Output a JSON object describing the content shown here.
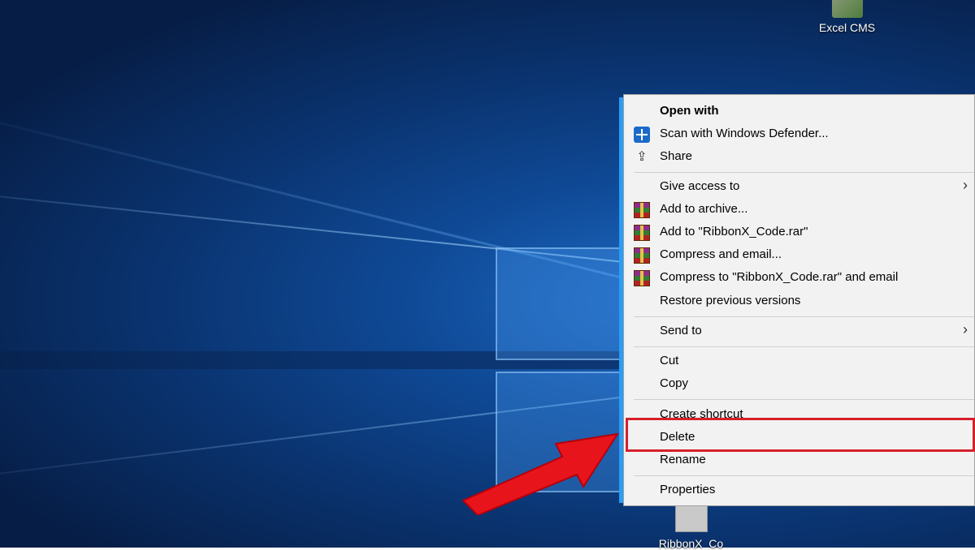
{
  "desktop": {
    "icons": [
      {
        "label": "Excel CMS",
        "icon": "excel-file-icon"
      },
      {
        "label": "RibbonX_Co",
        "icon": "file-icon"
      }
    ]
  },
  "context_menu": {
    "items": [
      {
        "label": "Open with",
        "bold": true
      },
      {
        "label": "Scan with Windows Defender...",
        "icon": "windows-defender-icon"
      },
      {
        "label": "Share",
        "icon": "share-icon"
      },
      {
        "label": "Give access to",
        "submenu": true
      },
      {
        "label": "Add to archive...",
        "icon": "winrar-icon"
      },
      {
        "label": "Add to \"RibbonX_Code.rar\"",
        "icon": "winrar-icon"
      },
      {
        "label": "Compress and email...",
        "icon": "winrar-icon"
      },
      {
        "label": "Compress to \"RibbonX_Code.rar\" and email",
        "icon": "winrar-icon"
      },
      {
        "label": "Restore previous versions"
      },
      {
        "label": "Send to",
        "submenu": true
      },
      {
        "label": "Cut"
      },
      {
        "label": "Copy"
      },
      {
        "label": "Create shortcut"
      },
      {
        "label": "Delete",
        "highlighted": true
      },
      {
        "label": "Rename"
      },
      {
        "label": "Properties"
      }
    ],
    "submenu_arrow": "›"
  },
  "annotation": {
    "highlight_color": "#d6202a",
    "arrow_color": "#e8141c"
  }
}
